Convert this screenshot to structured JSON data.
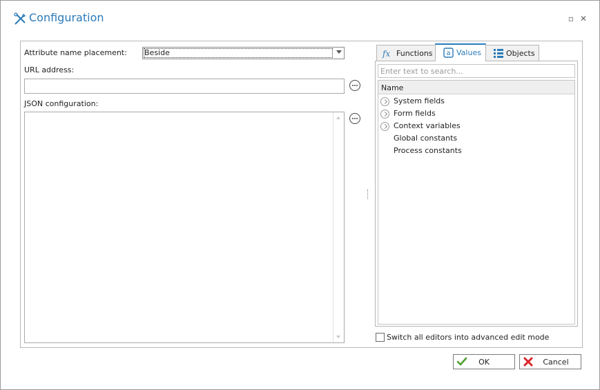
{
  "window": {
    "title": "Configuration",
    "icons": {
      "title_icon": "tools-icon",
      "maximize": "maximize-icon",
      "close": "close-icon"
    }
  },
  "form": {
    "attribute_label": "Attribute name placement:",
    "attribute_value": "Beside",
    "url_label": "URL address:",
    "url_value": "",
    "json_label": "JSON configuration:",
    "json_value": ""
  },
  "tabs": [
    {
      "label": "Functions",
      "icon": "fx-icon",
      "active": false
    },
    {
      "label": "Values",
      "icon": "values-icon",
      "active": true
    },
    {
      "label": "Objects",
      "icon": "objects-icon",
      "active": false
    }
  ],
  "values_panel": {
    "search_placeholder": "Enter text to search...",
    "column_header": "Name",
    "items": [
      {
        "label": "System fields",
        "expandable": true
      },
      {
        "label": "Form fields",
        "expandable": true
      },
      {
        "label": "Context variables",
        "expandable": true
      },
      {
        "label": "Global constants",
        "expandable": false
      },
      {
        "label": "Process constants",
        "expandable": false
      }
    ]
  },
  "advanced_mode": {
    "label": "Switch all editors into advanced edit mode",
    "checked": false
  },
  "buttons": {
    "ok": "OK",
    "cancel": "Cancel"
  },
  "colors": {
    "accent": "#2b7bb9",
    "ok_green": "#4aa02c",
    "cancel_red": "#d9262c"
  }
}
